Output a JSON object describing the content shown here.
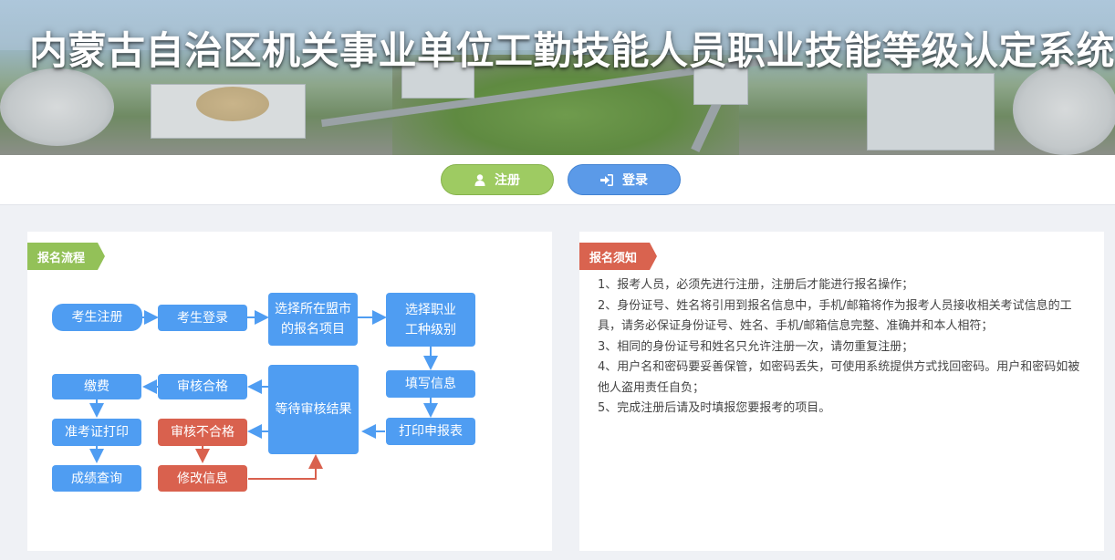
{
  "header": {
    "title": "内蒙古自治区机关事业单位工勤技能人员职业技能等级认定系统"
  },
  "auth": {
    "register_label": "注册",
    "login_label": "登录"
  },
  "process": {
    "tag": "报名流程",
    "nodes": {
      "exam_register": "考生注册",
      "exam_login": "考生登录",
      "choose_project_l1": "选择所在盟市",
      "choose_project_l2": "的报名项目",
      "choose_job_l1": "选择职业",
      "choose_job_l2": "工种级别",
      "fill_info": "填写信息",
      "print_form": "打印申报表",
      "await_review": "等待审核结果",
      "review_pass": "审核合格",
      "review_fail": "审核不合格",
      "modify_info": "修改信息",
      "pay": "缴费",
      "print_ticket": "准考证打印",
      "score_query": "成绩查询"
    }
  },
  "notice": {
    "tag": "报名须知",
    "items": [
      "1、报考人员，必须先进行注册，注册后才能进行报名操作；",
      "2、身份证号、姓名将引用到报名信息中，手机/邮箱将作为报考人员接收相关考试信息的工具，请务必保证身份证号、姓名、手机/邮箱信息完整、准确并和本人相符；",
      "3、相同的身份证号和姓名只允许注册一次，请勿重复注册；",
      "4、用户名和密码要妥善保管，如密码丢失，可使用系统提供方式找回密码。用户和密码如被他人盗用责任自负；",
      "5、完成注册后请及时填报您要报考的项目。"
    ]
  },
  "colors": {
    "blue": "#4f9df2",
    "red": "#d9614e",
    "green": "#93c158",
    "notice_red": "#d9634f"
  }
}
